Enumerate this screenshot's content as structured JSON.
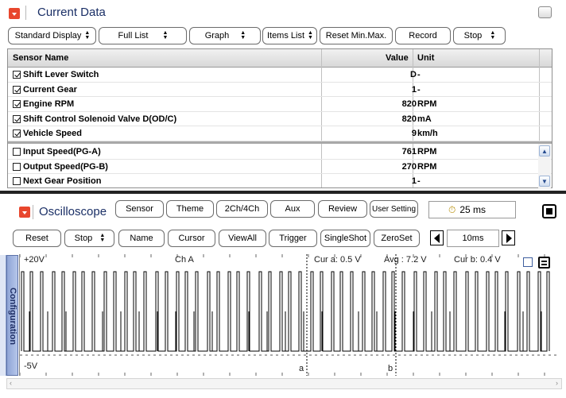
{
  "current_data": {
    "title": "Current Data",
    "toolbar": [
      {
        "label": "Standard Display",
        "dropdown": true
      },
      {
        "label": "Full List",
        "dropdown": true
      },
      {
        "label": "Graph",
        "dropdown": true
      },
      {
        "label": "Items List",
        "dropdown": true
      },
      {
        "label": "Reset Min.Max.",
        "dropdown": false
      },
      {
        "label": "Record",
        "dropdown": false
      },
      {
        "label": "Stop",
        "dropdown": true
      }
    ],
    "columns": {
      "name": "Sensor Name",
      "value": "Value",
      "unit": "Unit"
    },
    "rows": [
      {
        "name": "Shift Lever Switch",
        "value": "D",
        "unit": "-",
        "checked": true
      },
      {
        "name": "Current Gear",
        "value": "1",
        "unit": "-",
        "checked": true
      },
      {
        "name": "Engine RPM",
        "value": "820",
        "unit": "RPM",
        "checked": true
      },
      {
        "name": "Shift Control Solenoid Valve D(OD/C)",
        "value": "820",
        "unit": "mA",
        "checked": true
      },
      {
        "name": "Vehicle Speed",
        "value": "9",
        "unit": "km/h",
        "checked": true
      },
      {
        "name": "Input Speed(PG-A)",
        "value": "761",
        "unit": "RPM",
        "checked": false
      },
      {
        "name": "Output Speed(PG-B)",
        "value": "270",
        "unit": "RPM",
        "checked": false
      },
      {
        "name": "Next Gear Position",
        "value": "1",
        "unit": "-",
        "checked": false
      }
    ]
  },
  "oscilloscope": {
    "title": "Oscilloscope",
    "toolbar1": [
      {
        "label": "Sensor"
      },
      {
        "label": "Theme"
      },
      {
        "label": "2Ch/4Ch"
      },
      {
        "label": "Aux"
      },
      {
        "label": "Review"
      },
      {
        "label": "User Setting"
      }
    ],
    "time_readout": "25 ms",
    "toolbar2": [
      {
        "label": "Reset",
        "dropdown": false
      },
      {
        "label": "Stop",
        "dropdown": true
      },
      {
        "label": "Name",
        "dropdown": false
      },
      {
        "label": "Cursor",
        "dropdown": false
      },
      {
        "label": "ViewAll",
        "dropdown": false
      },
      {
        "label": "Trigger",
        "dropdown": false
      },
      {
        "label": "SingleShot",
        "dropdown": false
      },
      {
        "label": "ZeroSet",
        "dropdown": false
      }
    ],
    "timebase": "10ms",
    "config_tab": "Configuration",
    "plot": {
      "y_max_label": "+20V",
      "y_min_label": "-5V",
      "channel_label": "Ch A",
      "cursor_a_readout": "Cur a: 0.5 V",
      "average_readout": "Avg : 7.2 V",
      "cursor_b_readout": "Cur b: 0.4 V",
      "cursor_a_label": "a",
      "cursor_b_label": "b",
      "trace_color": "#000000",
      "cursor_line_color": "#000000"
    }
  },
  "icons": {
    "collapse": "collapse-arrow-icon",
    "maximize": "maximize-icon",
    "time": "stopwatch-icon",
    "stop": "stop-square-icon",
    "prev": "left-arrow-icon",
    "next": "right-arrow-icon"
  },
  "colors": {
    "accent": "#e8462d",
    "title_text": "#1a2f66",
    "divider": "#232323",
    "config_tab": "#8fa5d6"
  }
}
